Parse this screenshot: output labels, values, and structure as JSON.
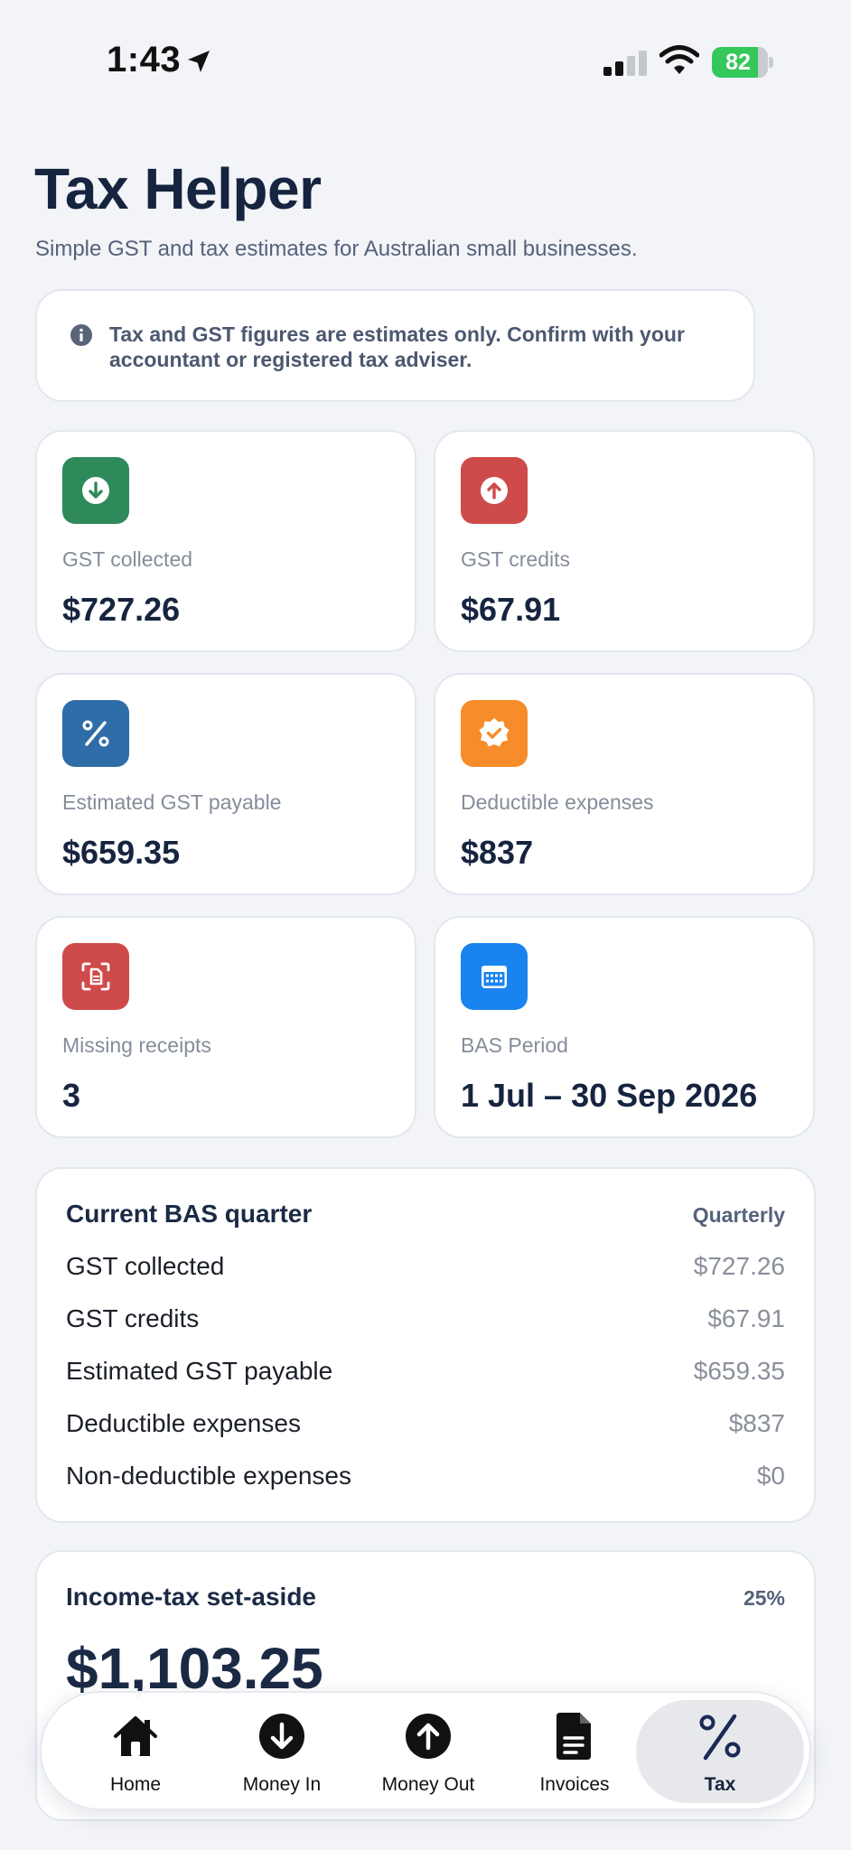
{
  "status_bar": {
    "time": "1:43",
    "battery": "82",
    "battery_level": 0.82
  },
  "header": {
    "title": "Tax Helper",
    "subtitle": "Simple GST and tax estimates for Australian small businesses."
  },
  "notice": {
    "text": "Tax and GST figures are estimates only. Confirm with your accountant or registered tax adviser."
  },
  "stats": [
    {
      "label": "GST collected",
      "value": "$727.26",
      "icon": "arrow-down-circle-icon",
      "color": "#2e8a5a"
    },
    {
      "label": "GST credits",
      "value": "$67.91",
      "icon": "arrow-up-circle-icon",
      "color": "#cf4b4b"
    },
    {
      "label": "Estimated GST payable",
      "value": "$659.35",
      "icon": "percent-icon",
      "color": "#2f6da8"
    },
    {
      "label": "Deductible expenses",
      "value": "$837",
      "icon": "verified-badge-icon",
      "color": "#f68c2a"
    },
    {
      "label": "Missing receipts",
      "value": "3",
      "icon": "receipt-scan-icon",
      "color": "#cf4b4b"
    },
    {
      "label": "BAS Period",
      "value": "1 Jul – 30 Sep 2026",
      "icon": "calendar-icon",
      "color": "#1983f0"
    }
  ],
  "bas": {
    "title": "Current BAS quarter",
    "tag": "Quarterly",
    "rows": [
      {
        "label": "GST collected",
        "value": "$727.26"
      },
      {
        "label": "GST credits",
        "value": "$67.91"
      },
      {
        "label": "Estimated GST payable",
        "value": "$659.35"
      },
      {
        "label": "Deductible expenses",
        "value": "$837"
      },
      {
        "label": "Non-deductible expenses",
        "value": "$0"
      }
    ]
  },
  "income_tax": {
    "title": "Income-tax set-aside",
    "rate": "25%",
    "amount": "$1,103.25"
  },
  "tabs": [
    {
      "label": "Home",
      "icon": "home-icon"
    },
    {
      "label": "Money In",
      "icon": "arrow-down-circle-icon"
    },
    {
      "label": "Money Out",
      "icon": "arrow-up-circle-icon"
    },
    {
      "label": "Invoices",
      "icon": "document-icon"
    },
    {
      "label": "Tax",
      "icon": "percent-icon",
      "active": true
    }
  ]
}
